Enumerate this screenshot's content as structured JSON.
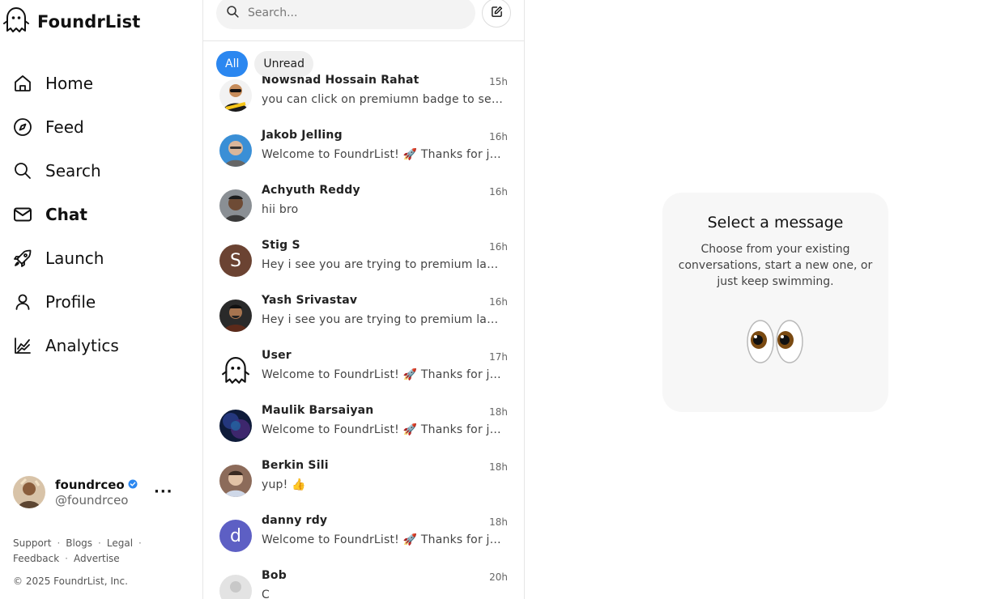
{
  "app": {
    "brand": "FoundrList"
  },
  "nav": [
    {
      "label": "Home",
      "icon": "home-icon"
    },
    {
      "label": "Feed",
      "icon": "compass-icon"
    },
    {
      "label": "Search",
      "icon": "search-icon"
    },
    {
      "label": "Chat",
      "icon": "mail-icon",
      "active": true
    },
    {
      "label": "Launch",
      "icon": "rocket-icon"
    },
    {
      "label": "Profile",
      "icon": "user-icon"
    },
    {
      "label": "Analytics",
      "icon": "chart-icon"
    }
  ],
  "user": {
    "name": "foundrceo",
    "handle": "@foundrceo",
    "more": "···"
  },
  "footer": {
    "links": [
      "Support",
      "Blogs",
      "Legal",
      "Feedback",
      "Advertise"
    ],
    "copyright": "© 2025 FoundrList, Inc."
  },
  "chat": {
    "search_placeholder": "Search...",
    "tabs": [
      "All",
      "Unread"
    ],
    "conversations": [
      {
        "name": "Nowshad Hossain Rahat",
        "time": "15h",
        "message": "you can click on premiumn badge to see features",
        "avatar": "photo-dark"
      },
      {
        "name": "Jakob Jelling",
        "time": "16h",
        "message": "Welcome to FoundrList! 🚀 Thanks for joining us!",
        "avatar": "photo-blue"
      },
      {
        "name": "Achyuth Reddy",
        "time": "16h",
        "message": "hii bro",
        "avatar": "photo-gray"
      },
      {
        "name": "Stig S",
        "time": "16h",
        "message": "Hey i see you are trying to premium launch your product",
        "avatar": "letter",
        "letter": "S",
        "color": "#6b4332"
      },
      {
        "name": "Yash Srivastav",
        "time": "16h",
        "message": "Hey i see you are trying to premium launch your product",
        "avatar": "photo-dark2"
      },
      {
        "name": "User",
        "time": "17h",
        "message": "Welcome to FoundrList! 🚀 Thanks for joining us!",
        "avatar": "ghost"
      },
      {
        "name": "Maulik Barsaiyan",
        "time": "18h",
        "message": "Welcome to FoundrList! 🚀 Thanks for joining us!",
        "avatar": "photo-night"
      },
      {
        "name": "Berkin Sili",
        "time": "18h",
        "message": "yup! 👍",
        "avatar": "photo-light"
      },
      {
        "name": "danny rdy",
        "time": "18h",
        "message": "Welcome to FoundrList! 🚀 Thanks for joining us!",
        "avatar": "letter",
        "letter": "d",
        "color": "#5d5fc4"
      },
      {
        "name": "Bob",
        "time": "20h",
        "message": "C",
        "avatar": "placeholder"
      }
    ]
  },
  "empty_state": {
    "title": "Select a message",
    "description": "Choose from your existing conversations, start a new one, or just keep swimming.",
    "emoji": "eyes-icon"
  }
}
